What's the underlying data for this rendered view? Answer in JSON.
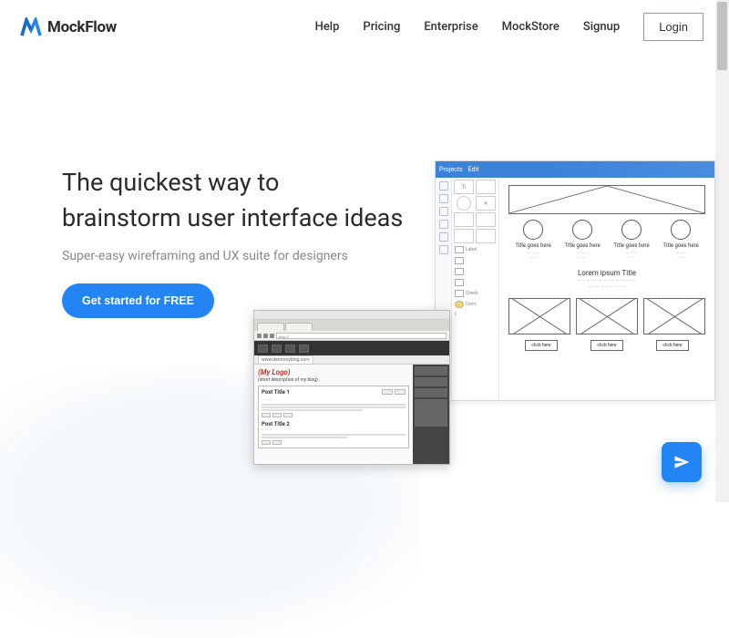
{
  "brand": {
    "name": "MockFlow"
  },
  "nav": {
    "help": "Help",
    "pricing": "Pricing",
    "enterprise": "Enterprise",
    "mockstore": "MockStore",
    "signup": "Signup",
    "login": "Login"
  },
  "hero": {
    "title_line1": "The quickest way to",
    "title_line2": "brainstorm user interface ideas",
    "subtitle": "Super-easy wireframing and UX suite for designers",
    "cta": "Get started for FREE"
  },
  "mockup_right": {
    "toolbar": [
      "Projects",
      "Edit"
    ],
    "circle_label": "Title goes here",
    "section_title": "Lorem ipsum Title",
    "button_label": "click here"
  },
  "mockup_left": {
    "url_text": "http://",
    "subbar_url": "www.demomyblog.com",
    "logo": "(My Logo)",
    "tagline": "(short description of my blog)",
    "post_title_1": "Post Title 1",
    "post_title_2": "Post Title 2"
  },
  "colors": {
    "accent": "#2384f3",
    "text_dark": "#2b2b2b",
    "text_muted": "#888"
  }
}
